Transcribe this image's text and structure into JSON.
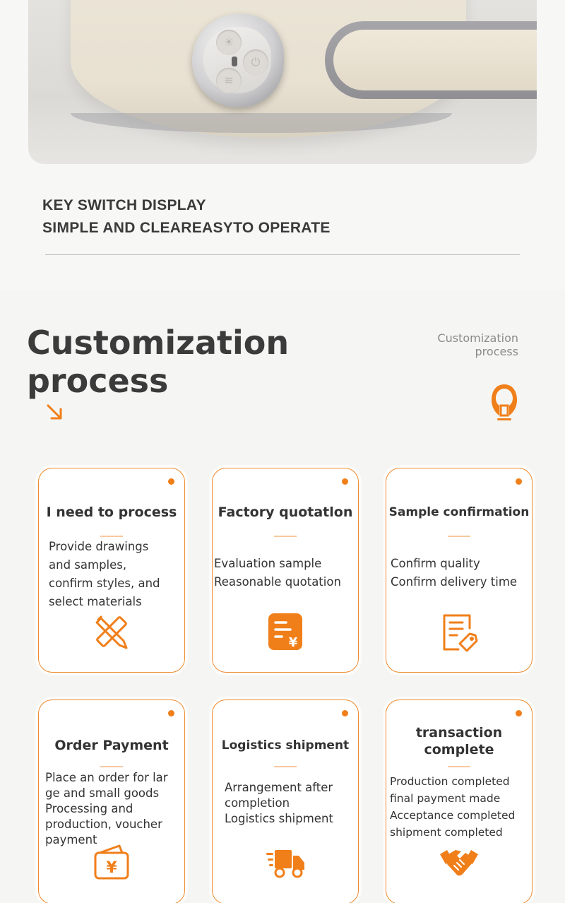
{
  "product": {
    "caption_line1": "KEY SWITCH DISPLAY",
    "caption_line2": "SIMPLE AND CLEAREASYTO OPERATE"
  },
  "section": {
    "title_line1": "Customization",
    "title_line2": "process",
    "side_label_line1": "Customization",
    "side_label_line2": "process"
  },
  "colors": {
    "accent": "#f07f1a",
    "card_border": "#f08a2c",
    "text": "#333333"
  },
  "cards": [
    {
      "title": "I need to process",
      "desc": "Provide drawings\nand samples,\nconfirm styles, and\nselect materials",
      "icon": "pencil-ruler-icon"
    },
    {
      "title": "Factory quotatlon",
      "desc": "Evaluation sample\nReasonable quotation",
      "icon": "yen-document-icon"
    },
    {
      "title": "Sample confirmation",
      "desc": "Confirm quality\nConfirm delivery time",
      "icon": "document-tag-icon"
    },
    {
      "title": "Order Payment",
      "desc": "Place an order for lar\nge and small goods\nProcessing and\nproduction, voucher\npayment",
      "icon": "yen-wallet-icon"
    },
    {
      "title": "Logistics shipment",
      "desc": "Arrangement after\ncompletion\nLogistics shipment",
      "icon": "delivery-truck-icon"
    },
    {
      "title_line1": "transaction",
      "title_line2": "complete",
      "desc": "Production completed\nfinal payment made\nAcceptance completed\nshipment completed",
      "icon": "handshake-icon"
    }
  ]
}
